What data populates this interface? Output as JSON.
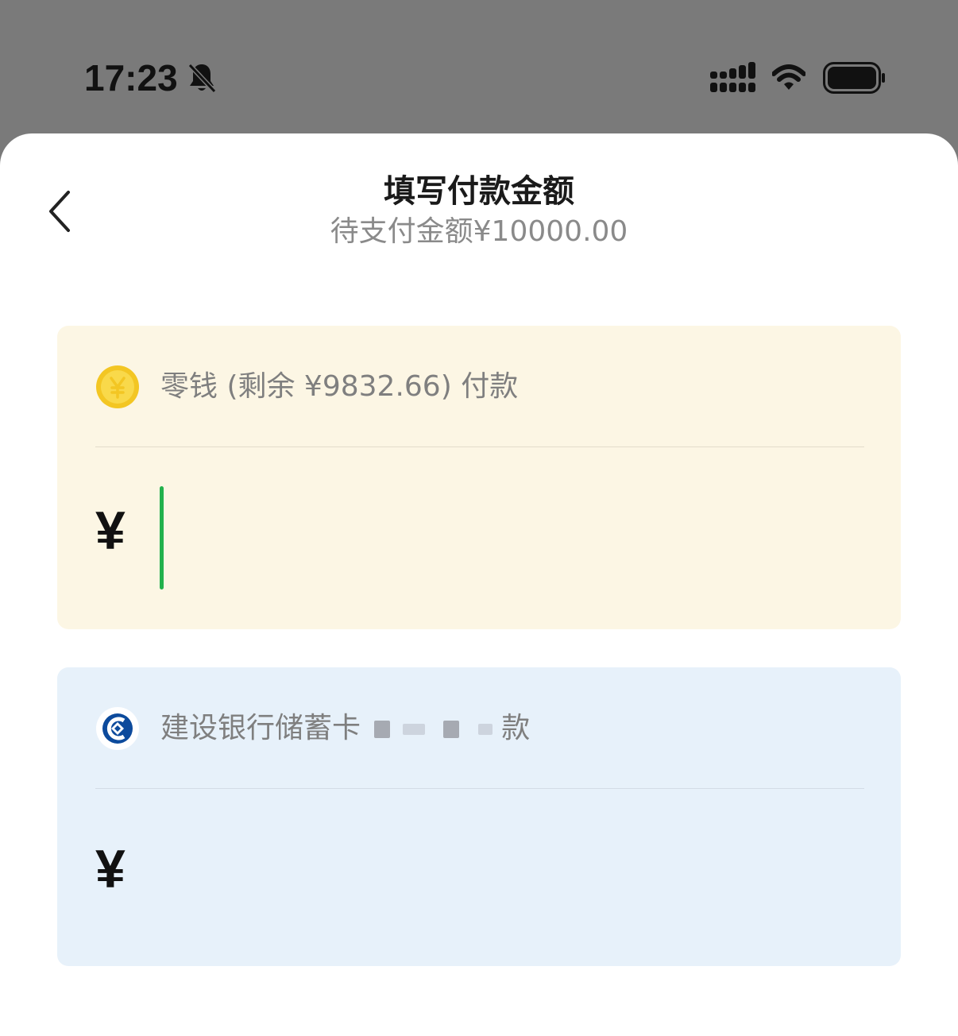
{
  "status_bar": {
    "time": "17:23",
    "icons": [
      "bell-muted-icon",
      "signal-icon",
      "wifi-icon",
      "battery-icon"
    ]
  },
  "header": {
    "back_icon": "chevron-left-icon",
    "title": "填写付款金额",
    "subtitle": "待支付金额¥10000.00"
  },
  "payment_sources": {
    "wallet": {
      "icon": "coin-icon",
      "label": "零钱 (剩余 ¥9832.66) 付款",
      "currency": "¥",
      "value": "",
      "background": "#fcf6e4",
      "focused": true
    },
    "bank": {
      "icon": "ccb-bank-icon",
      "label_prefix": "建设银行储蓄卡",
      "label_suffix": "款",
      "currency": "¥",
      "value": "",
      "background": "#e7f1fa"
    }
  },
  "colors": {
    "caret": "#22b14c",
    "coin": "#f7d23a",
    "ccb_blue": "#0c4a9c"
  }
}
